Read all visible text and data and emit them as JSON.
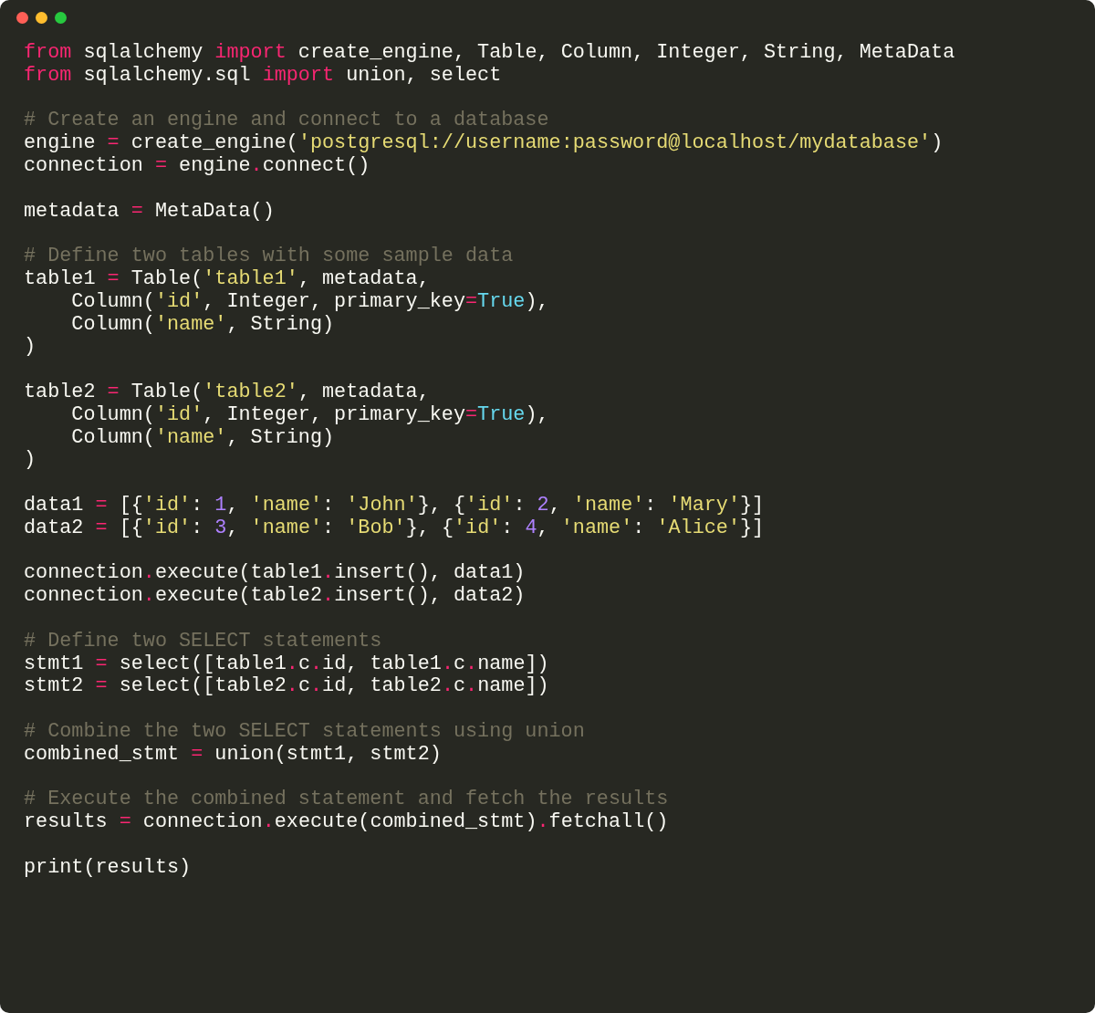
{
  "editor": {
    "blocks": [
      {
        "lines": [
          [
            {
              "kind": "keyword",
              "text": "from"
            },
            {
              "kind": "plain",
              "text": " sqlalchemy "
            },
            {
              "kind": "keyword",
              "text": "import"
            },
            {
              "kind": "plain",
              "text": " create_engine, Table, Column, Integer, String, MetaData"
            }
          ],
          [
            {
              "kind": "keyword",
              "text": "from"
            },
            {
              "kind": "plain",
              "text": " sqlalchemy.sql "
            },
            {
              "kind": "keyword",
              "text": "import"
            },
            {
              "kind": "plain",
              "text": " union, select"
            }
          ]
        ]
      },
      {
        "lines": [
          [
            {
              "kind": "comment",
              "text": "# Create an engine and connect to a database"
            }
          ],
          [
            {
              "kind": "plain",
              "text": "engine "
            },
            {
              "kind": "operator",
              "text": "="
            },
            {
              "kind": "plain",
              "text": " create_engine("
            },
            {
              "kind": "string",
              "text": "'postgresql://username:password@localhost/mydatabase'"
            },
            {
              "kind": "plain",
              "text": ")"
            }
          ],
          [
            {
              "kind": "plain",
              "text": "connection "
            },
            {
              "kind": "operator",
              "text": "="
            },
            {
              "kind": "plain",
              "text": " engine"
            },
            {
              "kind": "operator",
              "text": "."
            },
            {
              "kind": "plain",
              "text": "connect()"
            }
          ]
        ]
      },
      {
        "lines": [
          [
            {
              "kind": "plain",
              "text": "metadata "
            },
            {
              "kind": "operator",
              "text": "="
            },
            {
              "kind": "plain",
              "text": " MetaData()"
            }
          ]
        ]
      },
      {
        "lines": [
          [
            {
              "kind": "comment",
              "text": "# Define two tables with some sample data"
            }
          ],
          [
            {
              "kind": "plain",
              "text": "table1 "
            },
            {
              "kind": "operator",
              "text": "="
            },
            {
              "kind": "plain",
              "text": " Table("
            },
            {
              "kind": "string",
              "text": "'table1'"
            },
            {
              "kind": "plain",
              "text": ", metadata,"
            }
          ],
          [
            {
              "kind": "plain",
              "text": "    Column("
            },
            {
              "kind": "string",
              "text": "'id'"
            },
            {
              "kind": "plain",
              "text": ", Integer, primary_key"
            },
            {
              "kind": "operator",
              "text": "="
            },
            {
              "kind": "constant",
              "text": "True"
            },
            {
              "kind": "plain",
              "text": "),"
            }
          ],
          [
            {
              "kind": "plain",
              "text": "    Column("
            },
            {
              "kind": "string",
              "text": "'name'"
            },
            {
              "kind": "plain",
              "text": ", String)"
            }
          ],
          [
            {
              "kind": "plain",
              "text": ")"
            }
          ]
        ]
      },
      {
        "lines": [
          [
            {
              "kind": "plain",
              "text": "table2 "
            },
            {
              "kind": "operator",
              "text": "="
            },
            {
              "kind": "plain",
              "text": " Table("
            },
            {
              "kind": "string",
              "text": "'table2'"
            },
            {
              "kind": "plain",
              "text": ", metadata,"
            }
          ],
          [
            {
              "kind": "plain",
              "text": "    Column("
            },
            {
              "kind": "string",
              "text": "'id'"
            },
            {
              "kind": "plain",
              "text": ", Integer, primary_key"
            },
            {
              "kind": "operator",
              "text": "="
            },
            {
              "kind": "constant",
              "text": "True"
            },
            {
              "kind": "plain",
              "text": "),"
            }
          ],
          [
            {
              "kind": "plain",
              "text": "    Column("
            },
            {
              "kind": "string",
              "text": "'name'"
            },
            {
              "kind": "plain",
              "text": ", String)"
            }
          ],
          [
            {
              "kind": "plain",
              "text": ")"
            }
          ]
        ]
      },
      {
        "lines": [
          [
            {
              "kind": "plain",
              "text": "data1 "
            },
            {
              "kind": "operator",
              "text": "="
            },
            {
              "kind": "plain",
              "text": " [{"
            },
            {
              "kind": "string",
              "text": "'id'"
            },
            {
              "kind": "plain",
              "text": ": "
            },
            {
              "kind": "number",
              "text": "1"
            },
            {
              "kind": "plain",
              "text": ", "
            },
            {
              "kind": "string",
              "text": "'name'"
            },
            {
              "kind": "plain",
              "text": ": "
            },
            {
              "kind": "string",
              "text": "'John'"
            },
            {
              "kind": "plain",
              "text": "}, {"
            },
            {
              "kind": "string",
              "text": "'id'"
            },
            {
              "kind": "plain",
              "text": ": "
            },
            {
              "kind": "number",
              "text": "2"
            },
            {
              "kind": "plain",
              "text": ", "
            },
            {
              "kind": "string",
              "text": "'name'"
            },
            {
              "kind": "plain",
              "text": ": "
            },
            {
              "kind": "string",
              "text": "'Mary'"
            },
            {
              "kind": "plain",
              "text": "}]"
            }
          ],
          [
            {
              "kind": "plain",
              "text": "data2 "
            },
            {
              "kind": "operator",
              "text": "="
            },
            {
              "kind": "plain",
              "text": " [{"
            },
            {
              "kind": "string",
              "text": "'id'"
            },
            {
              "kind": "plain",
              "text": ": "
            },
            {
              "kind": "number",
              "text": "3"
            },
            {
              "kind": "plain",
              "text": ", "
            },
            {
              "kind": "string",
              "text": "'name'"
            },
            {
              "kind": "plain",
              "text": ": "
            },
            {
              "kind": "string",
              "text": "'Bob'"
            },
            {
              "kind": "plain",
              "text": "}, {"
            },
            {
              "kind": "string",
              "text": "'id'"
            },
            {
              "kind": "plain",
              "text": ": "
            },
            {
              "kind": "number",
              "text": "4"
            },
            {
              "kind": "plain",
              "text": ", "
            },
            {
              "kind": "string",
              "text": "'name'"
            },
            {
              "kind": "plain",
              "text": ": "
            },
            {
              "kind": "string",
              "text": "'Alice'"
            },
            {
              "kind": "plain",
              "text": "}]"
            }
          ]
        ]
      },
      {
        "lines": [
          [
            {
              "kind": "plain",
              "text": "connection"
            },
            {
              "kind": "operator",
              "text": "."
            },
            {
              "kind": "plain",
              "text": "execute(table1"
            },
            {
              "kind": "operator",
              "text": "."
            },
            {
              "kind": "plain",
              "text": "insert(), data1)"
            }
          ],
          [
            {
              "kind": "plain",
              "text": "connection"
            },
            {
              "kind": "operator",
              "text": "."
            },
            {
              "kind": "plain",
              "text": "execute(table2"
            },
            {
              "kind": "operator",
              "text": "."
            },
            {
              "kind": "plain",
              "text": "insert(), data2)"
            }
          ]
        ]
      },
      {
        "lines": [
          [
            {
              "kind": "comment",
              "text": "# Define two SELECT statements"
            }
          ],
          [
            {
              "kind": "plain",
              "text": "stmt1 "
            },
            {
              "kind": "operator",
              "text": "="
            },
            {
              "kind": "plain",
              "text": " select([table1"
            },
            {
              "kind": "operator",
              "text": "."
            },
            {
              "kind": "plain",
              "text": "c"
            },
            {
              "kind": "operator",
              "text": "."
            },
            {
              "kind": "plain",
              "text": "id, table1"
            },
            {
              "kind": "operator",
              "text": "."
            },
            {
              "kind": "plain",
              "text": "c"
            },
            {
              "kind": "operator",
              "text": "."
            },
            {
              "kind": "plain",
              "text": "name])"
            }
          ],
          [
            {
              "kind": "plain",
              "text": "stmt2 "
            },
            {
              "kind": "operator",
              "text": "="
            },
            {
              "kind": "plain",
              "text": " select([table2"
            },
            {
              "kind": "operator",
              "text": "."
            },
            {
              "kind": "plain",
              "text": "c"
            },
            {
              "kind": "operator",
              "text": "."
            },
            {
              "kind": "plain",
              "text": "id, table2"
            },
            {
              "kind": "operator",
              "text": "."
            },
            {
              "kind": "plain",
              "text": "c"
            },
            {
              "kind": "operator",
              "text": "."
            },
            {
              "kind": "plain",
              "text": "name])"
            }
          ]
        ]
      },
      {
        "lines": [
          [
            {
              "kind": "comment",
              "text": "# Combine the two SELECT statements using union"
            }
          ],
          [
            {
              "kind": "plain",
              "text": "combined_stmt "
            },
            {
              "kind": "operator",
              "text": "="
            },
            {
              "kind": "plain",
              "text": " union(stmt1, stmt2)"
            }
          ]
        ]
      },
      {
        "lines": [
          [
            {
              "kind": "comment",
              "text": "# Execute the combined statement and fetch the results"
            }
          ],
          [
            {
              "kind": "plain",
              "text": "results "
            },
            {
              "kind": "operator",
              "text": "="
            },
            {
              "kind": "plain",
              "text": " connection"
            },
            {
              "kind": "operator",
              "text": "."
            },
            {
              "kind": "plain",
              "text": "execute(combined_stmt)"
            },
            {
              "kind": "operator",
              "text": "."
            },
            {
              "kind": "plain",
              "text": "fetchall()"
            }
          ]
        ]
      },
      {
        "lines": [
          [
            {
              "kind": "plain",
              "text": "print(results)"
            }
          ]
        ]
      }
    ]
  }
}
